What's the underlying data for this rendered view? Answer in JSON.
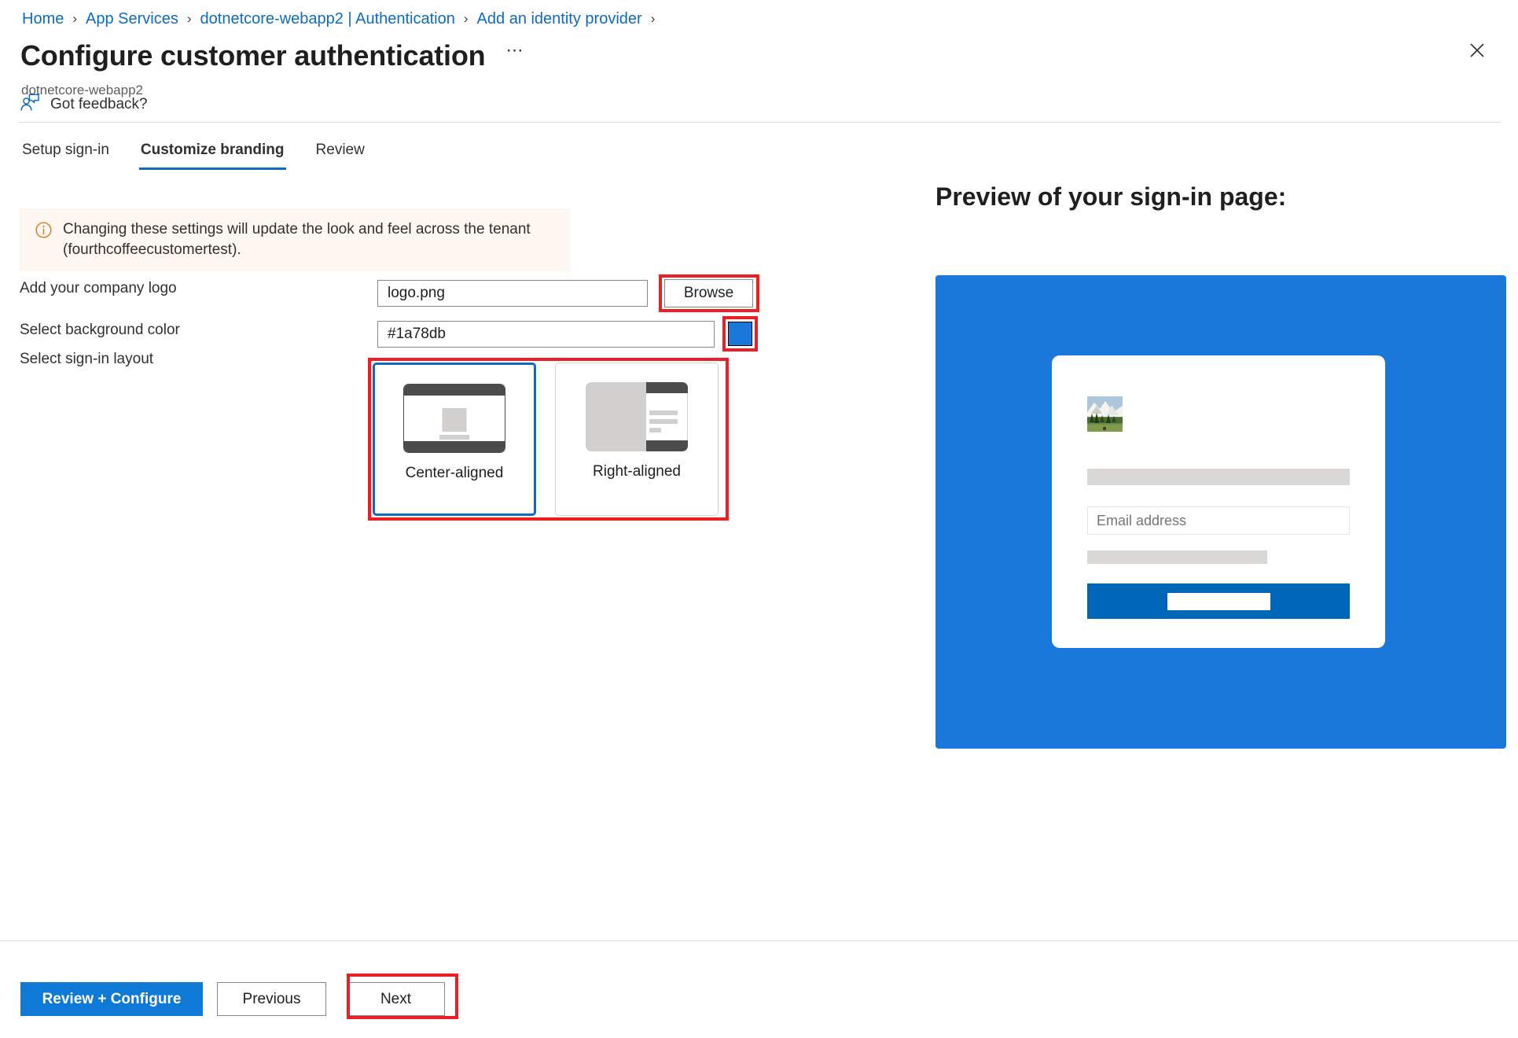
{
  "breadcrumb": {
    "separator": "›",
    "items": [
      {
        "label": "Home"
      },
      {
        "label": "App Services"
      },
      {
        "label": "dotnetcore-webapp2 | Authentication"
      },
      {
        "label": "Add an identity provider"
      }
    ]
  },
  "header": {
    "title": "Configure customer authentication",
    "ellipsis": "⋯",
    "subtitle": "dotnetcore-webapp2",
    "close_icon": "close-icon"
  },
  "command_bar": {
    "feedback_label": "Got feedback?",
    "feedback_icon": "feedback-person-icon"
  },
  "tabs": [
    {
      "label": "Setup sign-in",
      "active": false
    },
    {
      "label": "Customize branding",
      "active": true
    },
    {
      "label": "Review",
      "active": false
    }
  ],
  "banner": {
    "icon": "info-circle-icon",
    "text": "Changing these settings will update the look and feel across the tenant (fourthcoffeecustomertest)."
  },
  "form": {
    "logo": {
      "label": "Add your company logo",
      "value": "logo.png",
      "placeholder": "",
      "browse_label": "Browse"
    },
    "background_color": {
      "label": "Select background color",
      "value": "#1a78db",
      "placeholder": "",
      "swatch_color": "#1a78db"
    },
    "layout": {
      "label": "Select sign-in layout",
      "options": [
        {
          "caption": "Center-aligned",
          "selected": true
        },
        {
          "caption": "Right-aligned",
          "selected": false
        }
      ]
    }
  },
  "preview": {
    "heading": "Preview of your sign-in page:",
    "background_color": "#1a78db",
    "card": {
      "logo_alt": "company-logo-thumbnail",
      "email_placeholder": "Email address",
      "button_color": "#0067b8"
    }
  },
  "footer": {
    "review_configure_label": "Review + Configure",
    "previous_label": "Previous",
    "next_label": "Next"
  },
  "colors": {
    "accent": "#0f6cbd",
    "annotation": "#ee1f24",
    "primary_button": "#0f79d6",
    "banner_bg": "#fdf6f1",
    "banner_icon": "#d87b20"
  }
}
